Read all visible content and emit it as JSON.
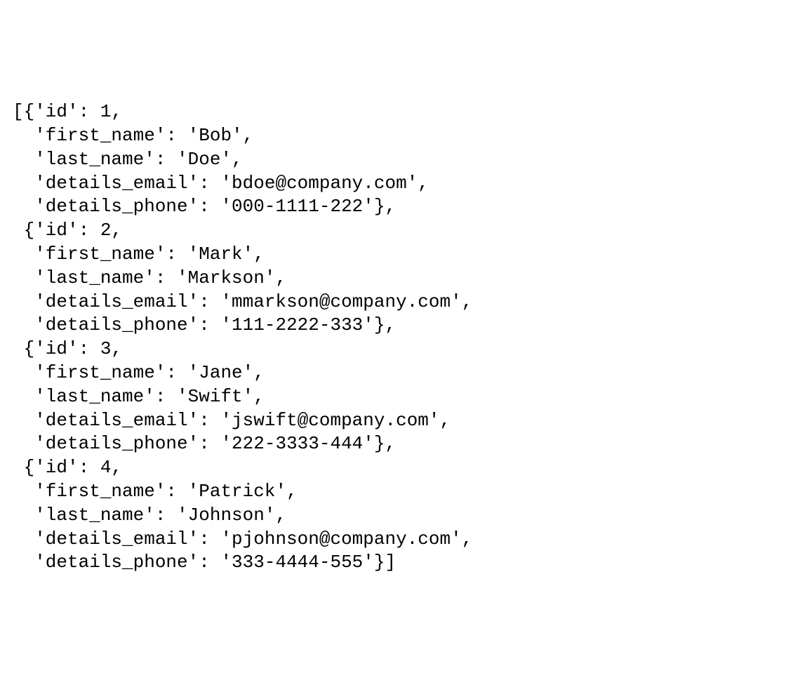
{
  "records": [
    {
      "id": 1,
      "first_name": "Bob",
      "last_name": "Doe",
      "details_email": "bdoe@company.com",
      "details_phone": "000-1111-222"
    },
    {
      "id": 2,
      "first_name": "Mark",
      "last_name": "Markson",
      "details_email": "mmarkson@company.com",
      "details_phone": "111-2222-333"
    },
    {
      "id": 3,
      "first_name": "Jane",
      "last_name": "Swift",
      "details_email": "jswift@company.com",
      "details_phone": "222-3333-444"
    },
    {
      "id": 4,
      "first_name": "Patrick",
      "last_name": "Johnson",
      "details_email": "pjohnson@company.com",
      "details_phone": "333-4444-555"
    }
  ],
  "keys_order": [
    "id",
    "first_name",
    "last_name",
    "details_email",
    "details_phone"
  ],
  "quote_char": "'"
}
